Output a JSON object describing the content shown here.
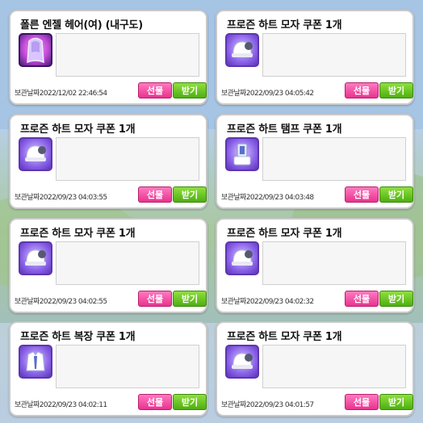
{
  "colors": {
    "gift_button": "#e8338f",
    "receive_button": "#4fae12",
    "card_border": "#c9c9c9",
    "message_box": "#f6f6f6"
  },
  "items": [
    {
      "title": "폴른 엔젤 헤어(여) (내구도)",
      "icon": "hair-icon",
      "date_label": "보관날짜",
      "date_value": "2022/12/02 22:46:54",
      "gift_label": "선물",
      "receive_label": "받기"
    },
    {
      "title": "프로즌 하트 모자 쿠폰 1개",
      "icon": "hat-coupon-icon",
      "date_label": "보관날짜",
      "date_value": "2022/09/23 04:05:42",
      "gift_label": "선물",
      "receive_label": "받기"
    },
    {
      "title": "프로즌 하트 모자 쿠폰 1개",
      "icon": "hat-coupon-icon",
      "date_label": "보관날짜",
      "date_value": "2022/09/23 04:03:55",
      "gift_label": "선물",
      "receive_label": "받기"
    },
    {
      "title": "프로즌 하트 탬프 쿠폰 1개",
      "icon": "lamp-coupon-icon",
      "date_label": "보관날짜",
      "date_value": "2022/09/23 04:03:48",
      "gift_label": "선물",
      "receive_label": "받기"
    },
    {
      "title": "프로즌 하트 모자 쿠폰 1개",
      "icon": "hat-coupon-icon",
      "date_label": "보관날짜",
      "date_value": "2022/09/23 04:02:55",
      "gift_label": "선물",
      "receive_label": "받기"
    },
    {
      "title": "프로즌 하트 모자 쿠폰 1개",
      "icon": "hat-coupon-icon",
      "date_label": "보관날짜",
      "date_value": "2022/09/23 04:02:32",
      "gift_label": "선물",
      "receive_label": "받기"
    },
    {
      "title": "프로즌 하트 복장 쿠폰 1개",
      "icon": "outfit-coupon-icon",
      "date_label": "보관날짜",
      "date_value": "2022/09/23 04:02:11",
      "gift_label": "선물",
      "receive_label": "받기"
    },
    {
      "title": "프로즌 하트 모자 쿠폰 1개",
      "icon": "hat-coupon-icon",
      "date_label": "보관날짜",
      "date_value": "2022/09/23 04:01:57",
      "gift_label": "선물",
      "receive_label": "받기"
    }
  ]
}
